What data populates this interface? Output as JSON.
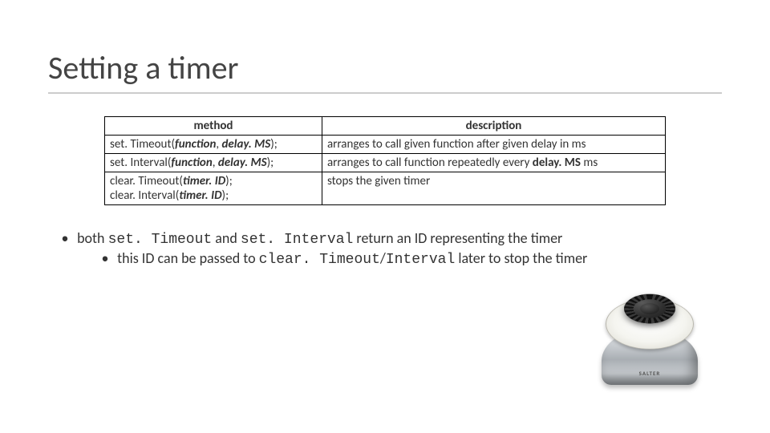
{
  "title": "Setting a timer",
  "table": {
    "headers": {
      "method": "method",
      "description": "description"
    },
    "rows": [
      {
        "m_a": "set. Timeout(",
        "m_b": "function",
        "m_c": ", ",
        "m_d": "delay. MS",
        "m_e": ");",
        "d_a": "arranges to call given function after given delay in ms"
      },
      {
        "m_a": "set. Interval(",
        "m_b": "function",
        "m_c": ", ",
        "m_d": "delay. MS",
        "m_e": ");",
        "d_a": "arranges to call function repeatedly every ",
        "d_b": "delay. MS",
        "d_c": " ms"
      },
      {
        "m_a": "clear. Timeout(",
        "m_b": "timer. ID",
        "m_c": ");",
        "m2_a": "clear. Interval(",
        "m2_b": "timer. ID",
        "m2_c": ");",
        "d_a": "stops the given timer"
      }
    ]
  },
  "bullets": {
    "l1_a": "both ",
    "l1_b": "set. Timeout",
    "l1_c": " and ",
    "l1_d": "set. Interval",
    "l1_e": " return an ID representing the timer",
    "l2_a": "this ID can be passed to ",
    "l2_b": "clear. Timeout",
    "l2_c": "/",
    "l2_d": "Interval",
    "l2_e": " later to stop the timer"
  },
  "timer_brand": "SALTER"
}
